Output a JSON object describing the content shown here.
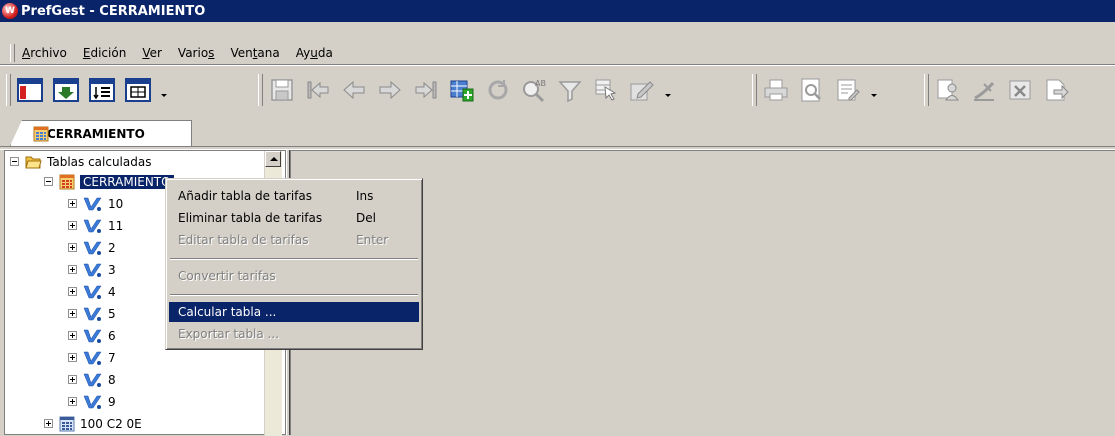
{
  "window": {
    "title": "PrefGest -  CERRAMIENTO",
    "logo_text": "W"
  },
  "menubar": {
    "items": [
      {
        "pre": "",
        "key": "A",
        "post": "rchivo"
      },
      {
        "pre": "",
        "key": "E",
        "post": "dición"
      },
      {
        "pre": "",
        "key": "V",
        "post": "er"
      },
      {
        "pre": "Vario",
        "key": "s",
        "post": ""
      },
      {
        "pre": "Ven",
        "key": "t",
        "post": "ana"
      },
      {
        "pre": "Ay",
        "key": "u",
        "post": "da"
      }
    ]
  },
  "tabs": [
    {
      "label": "CERRAMIENTO"
    }
  ],
  "tree": {
    "root": {
      "label": "Tablas calculadas"
    },
    "selected": {
      "label": "CERRAMIENTO"
    },
    "children": [
      "10",
      "11",
      "2",
      "3",
      "4",
      "5",
      "6",
      "7",
      "8",
      "9"
    ],
    "sibling": {
      "label": "100 C2 0E"
    }
  },
  "context_menu": {
    "items": [
      {
        "label": "Añadir tabla de tarifas",
        "key": "Ins"
      },
      {
        "label": "Eliminar  tabla de tarifas",
        "key": "Del"
      },
      {
        "label": "Editar  tabla de tarifas",
        "key": "Enter"
      },
      {
        "label": "Convertir tarifas",
        "key": ""
      },
      {
        "label": "Calcular tabla ...",
        "key": ""
      },
      {
        "label": "Exportar tabla ...",
        "key": ""
      }
    ]
  },
  "colors": {
    "titlebar": "#0a246a",
    "selection": "#0a246a",
    "face": "#d4d0c8",
    "disabled_text": "#808080"
  },
  "icons": {
    "toolbar1": [
      "window-icon",
      "import-icon",
      "list-icon",
      "grid-icon"
    ],
    "toolbar2": [
      "save-icon",
      "first-record-icon",
      "prev-record-icon",
      "next-record-icon",
      "last-record-icon",
      "add-record-icon",
      "refresh-icon",
      "find-icon",
      "filter-icon",
      "select-icon",
      "edit-icon"
    ],
    "toolbar3": [
      "print-icon",
      "preview-icon",
      "report-icon"
    ],
    "toolbar4": [
      "users-icon",
      "edit-doc-icon",
      "delete-doc-icon",
      "export-doc-icon"
    ]
  }
}
